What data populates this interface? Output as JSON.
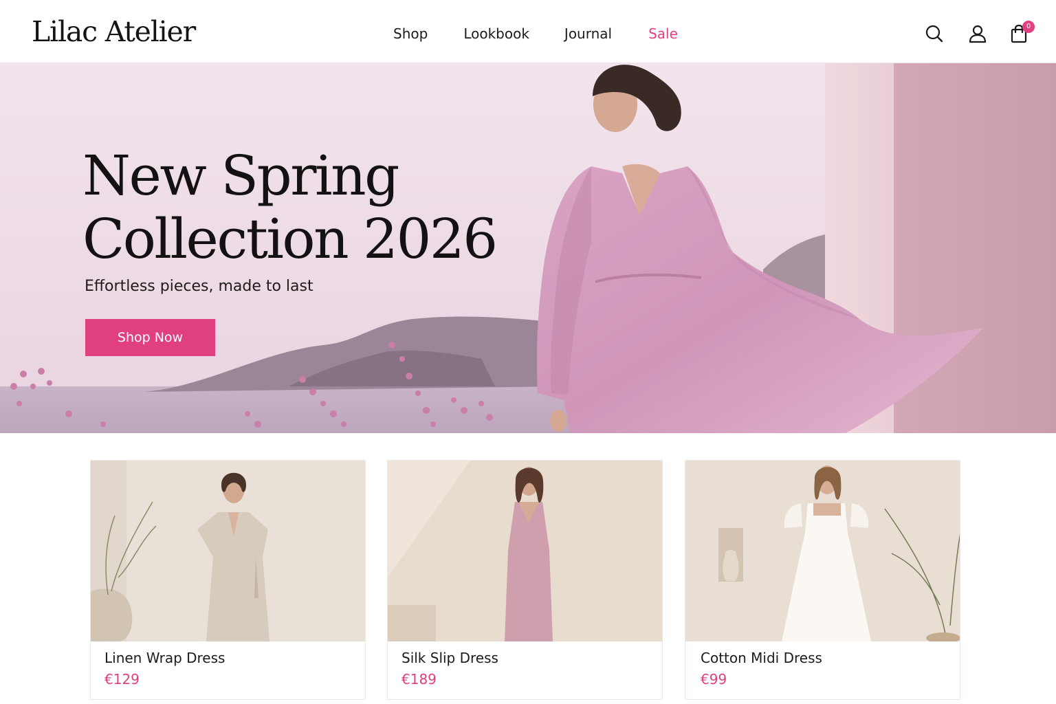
{
  "brand": {
    "name": "Lilac Atelier"
  },
  "nav": {
    "items": [
      {
        "label": "Shop"
      },
      {
        "label": "Lookbook"
      },
      {
        "label": "Journal"
      },
      {
        "label": "Sale"
      }
    ]
  },
  "header_icons": {
    "search": "search-icon",
    "account": "user-icon",
    "cart": "shopping-bag-icon",
    "cart_count": "0"
  },
  "hero": {
    "title": "New Spring Collection 2026",
    "subtitle": "Effortless pieces, made to last",
    "cta_label": "Shop Now",
    "image": "model-in-flowing-pink-dress-by-the-sea"
  },
  "products": [
    {
      "name": "Linen Wrap Dress",
      "price": "€129",
      "image": "model-in-beige-linen-wrap-dress"
    },
    {
      "name": "Silk Slip Dress",
      "price": "€189",
      "image": "model-in-pink-silk-slip-dress"
    },
    {
      "name": "Cotton Midi Dress",
      "price": "€99",
      "image": "model-in-white-cotton-midi-dress"
    }
  ],
  "colors": {
    "accent": "#e0407f",
    "text": "#1a1718",
    "hero_background": "#ead6e2",
    "border": "#ece6e9"
  }
}
